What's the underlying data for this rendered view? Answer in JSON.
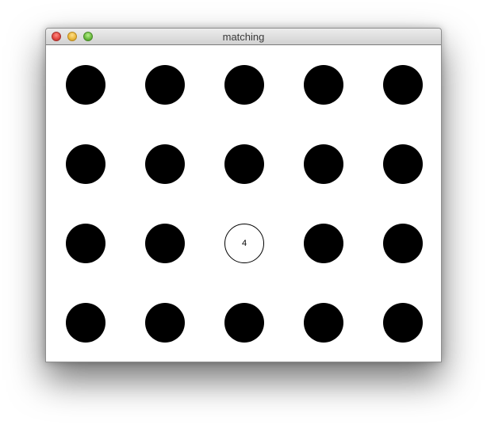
{
  "window": {
    "title": "matching"
  },
  "board": {
    "rows": 4,
    "cols": 5,
    "cells": [
      {
        "state": "hidden",
        "label": ""
      },
      {
        "state": "hidden",
        "label": ""
      },
      {
        "state": "hidden",
        "label": ""
      },
      {
        "state": "hidden",
        "label": ""
      },
      {
        "state": "hidden",
        "label": ""
      },
      {
        "state": "hidden",
        "label": ""
      },
      {
        "state": "hidden",
        "label": ""
      },
      {
        "state": "hidden",
        "label": ""
      },
      {
        "state": "hidden",
        "label": ""
      },
      {
        "state": "hidden",
        "label": ""
      },
      {
        "state": "hidden",
        "label": ""
      },
      {
        "state": "hidden",
        "label": ""
      },
      {
        "state": "revealed",
        "label": "4"
      },
      {
        "state": "hidden",
        "label": ""
      },
      {
        "state": "hidden",
        "label": ""
      },
      {
        "state": "hidden",
        "label": ""
      },
      {
        "state": "hidden",
        "label": ""
      },
      {
        "state": "hidden",
        "label": ""
      },
      {
        "state": "hidden",
        "label": ""
      },
      {
        "state": "hidden",
        "label": ""
      }
    ]
  }
}
